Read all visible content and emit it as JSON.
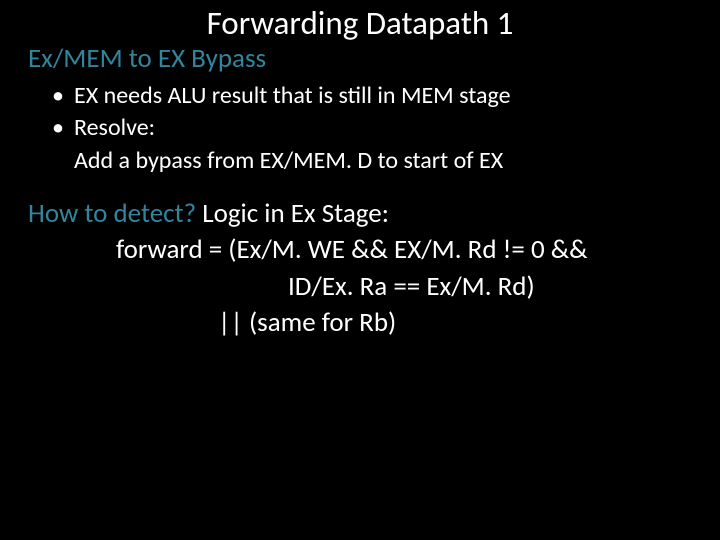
{
  "title": "Forwarding Datapath 1",
  "subtitle": "Ex/MEM to EX Bypass",
  "bullet1": "EX needs ALU result that is still in MEM stage",
  "bullet2_head": "Resolve:",
  "bullet2_body": "Add a bypass from EX/MEM. D to start of EX",
  "detect_q": "How to detect? ",
  "detect_rest": "Logic in Ex Stage:",
  "detect_l2": "forward = (Ex/M. WE && EX/M. Rd != 0 &&",
  "detect_l3": "ID/Ex. Ra == Ex/M. Rd)",
  "detect_l4": "|| (same for Rb)",
  "dot": "•"
}
